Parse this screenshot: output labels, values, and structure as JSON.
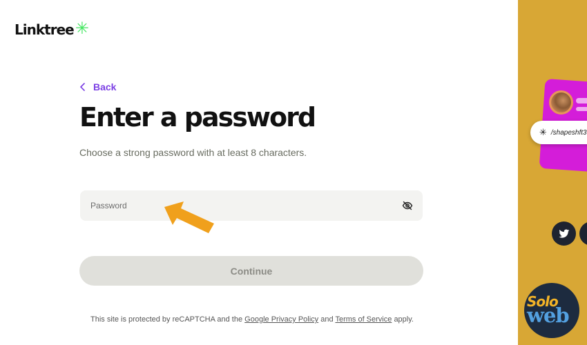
{
  "brand": {
    "name": "Linktree",
    "mark": "✳"
  },
  "nav": {
    "back_label": "Back"
  },
  "header": {
    "title": "Enter a password",
    "subtitle": "Choose a strong password with at least 8 characters."
  },
  "form": {
    "password_placeholder": "Password",
    "password_value": "",
    "continue_label": "Continue"
  },
  "legal": {
    "prefix": "This site is protected by reCAPTCHA and the",
    "privacy_link": "Google Privacy Policy",
    "and": "and",
    "terms_link": "Terms of Service",
    "suffix": "apply."
  },
  "preview": {
    "link_star": "✳",
    "link_text": "/shapeshft3"
  },
  "watermark": {
    "top": "Solo",
    "bottom": "web"
  },
  "colors": {
    "accent": "#7b3fe4",
    "brand_green": "#43e660",
    "panel_bg": "#d8a735",
    "card": "#d41dd9",
    "arrow": "#f0a01c",
    "button_disabled": "#e0e0db"
  },
  "icons": {
    "back": "chevron-left-icon",
    "eye": "eye-slash-icon",
    "twitter": "twitter-icon",
    "annotation": "arrow-icon"
  }
}
